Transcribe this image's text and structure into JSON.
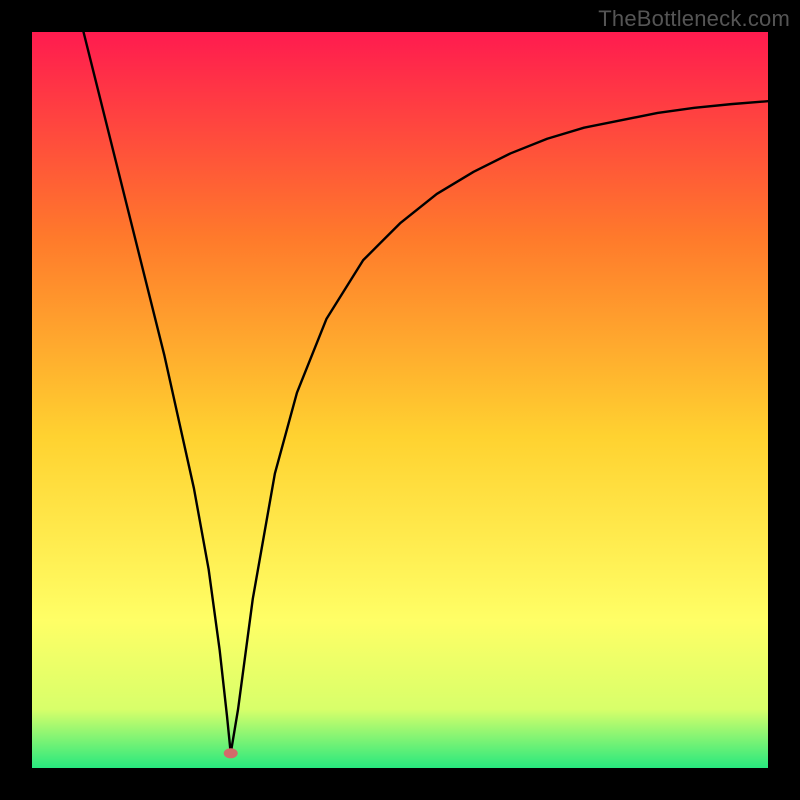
{
  "watermark": "TheBottleneck.com",
  "chart_data": {
    "type": "line",
    "title": "",
    "xlabel": "",
    "ylabel": "",
    "xlim": [
      0,
      100
    ],
    "ylim": [
      0,
      100
    ],
    "grid": false,
    "legend": false,
    "annotations": [],
    "background_gradient": {
      "top": "#ff1b4f",
      "mid_upper": "#ff7a2b",
      "mid": "#ffd230",
      "mid_lower": "#ffff66",
      "near_bottom": "#d8ff6a",
      "bottom": "#27e87e"
    },
    "series": [
      {
        "name": "left-branch",
        "x": [
          7,
          8,
          10,
          12,
          14,
          16,
          18,
          20,
          22,
          24,
          25.5,
          26.5,
          27
        ],
        "y": [
          100,
          96,
          88,
          80,
          72,
          64,
          56,
          47,
          38,
          27,
          16,
          7,
          2
        ]
      },
      {
        "name": "right-branch",
        "x": [
          27,
          28,
          30,
          33,
          36,
          40,
          45,
          50,
          55,
          60,
          65,
          70,
          75,
          80,
          85,
          90,
          95,
          100
        ],
        "y": [
          2,
          8,
          23,
          40,
          51,
          61,
          69,
          74,
          78,
          81,
          83.5,
          85.5,
          87,
          88,
          89,
          89.7,
          90.2,
          90.6
        ]
      }
    ],
    "marker": {
      "name": "minimum-point",
      "x": 27,
      "y": 2,
      "color": "#d46a6a",
      "rx": 7,
      "ry": 5
    }
  }
}
